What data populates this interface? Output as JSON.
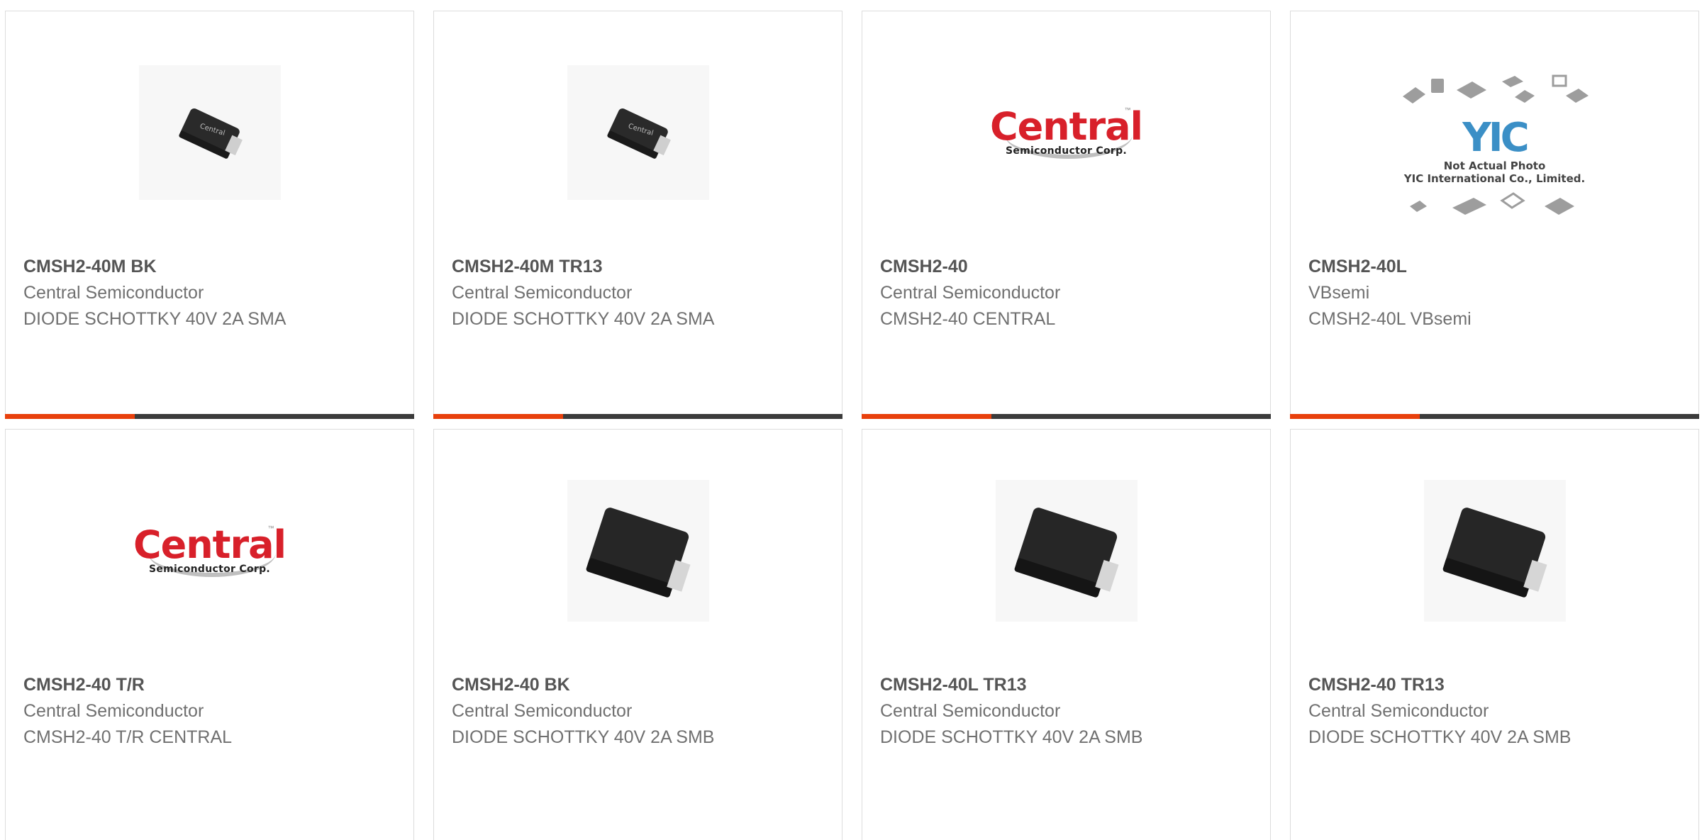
{
  "products": [
    {
      "part": "CMSH2-40M BK",
      "manufacturer": "Central Semiconductor",
      "description": "DIODE SCHOTTKY 40V 2A SMA",
      "image": "sma-package-photo"
    },
    {
      "part": "CMSH2-40M TR13",
      "manufacturer": "Central Semiconductor",
      "description": "DIODE SCHOTTKY 40V 2A SMA",
      "image": "sma-package-photo"
    },
    {
      "part": "CMSH2-40",
      "manufacturer": "Central Semiconductor",
      "description": "CMSH2-40 CENTRAL",
      "image": "central-logo"
    },
    {
      "part": "CMSH2-40L",
      "manufacturer": "VBsemi",
      "description": "CMSH2-40L VBsemi",
      "image": "not-actual-photo-placeholder"
    },
    {
      "part": "CMSH2-40 T/R",
      "manufacturer": "Central Semiconductor",
      "description": "CMSH2-40 T/R CENTRAL",
      "image": "central-logo"
    },
    {
      "part": "CMSH2-40 BK",
      "manufacturer": "Central Semiconductor",
      "description": "DIODE SCHOTTKY 40V 2A SMB",
      "image": "smb-package-photo"
    },
    {
      "part": "CMSH2-40L TR13",
      "manufacturer": "Central Semiconductor",
      "description": "DIODE SCHOTTKY 40V 2A SMB",
      "image": "smb-package-photo"
    },
    {
      "part": "CMSH2-40 TR13",
      "manufacturer": "Central Semiconductor",
      "description": "DIODE SCHOTTKY 40V 2A SMB",
      "image": "smb-package-photo"
    }
  ],
  "logos": {
    "central_word": "Central",
    "central_sub": "Semiconductor Corp.",
    "central_tm": "™",
    "yic_mark": "YIC",
    "yic_caption_1": "Not Actual Photo",
    "yic_caption_2": "YIC International Co., Limited."
  },
  "colors": {
    "accent": "#e8400c",
    "bar": "#3b3b3b",
    "central_red": "#d8202a",
    "yic_blue": "#3b8fc6"
  }
}
